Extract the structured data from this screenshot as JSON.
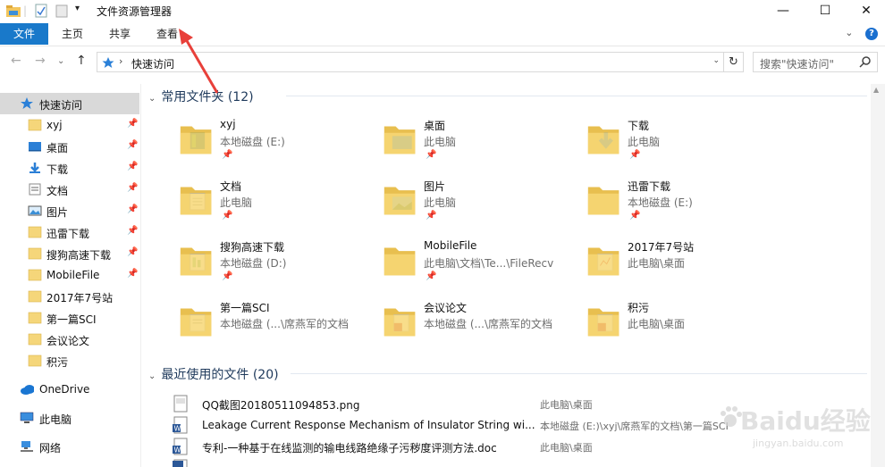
{
  "window": {
    "title": "文件资源管理器",
    "controls": {
      "minimize": "—",
      "maximize": "☐",
      "close": "✕"
    }
  },
  "ribbon": {
    "tabs": [
      {
        "label": "文件"
      },
      {
        "label": "主页"
      },
      {
        "label": "共享"
      },
      {
        "label": "查看"
      }
    ],
    "expand": "⌄"
  },
  "address": {
    "back": "←",
    "forward": "→",
    "recent": "⌄",
    "up": "↑",
    "separator": "›",
    "path": "快速访问",
    "dropdown": "⌄",
    "refresh": "↻",
    "search_placeholder": "搜索\"快速访问\""
  },
  "sidebar": {
    "quick_access": "快速访问",
    "items": [
      {
        "label": "xyj",
        "pinned": true,
        "icon": "folder-icon"
      },
      {
        "label": "桌面",
        "pinned": true,
        "icon": "desktop-icon"
      },
      {
        "label": "下载",
        "pinned": true,
        "icon": "download-icon"
      },
      {
        "label": "文档",
        "pinned": true,
        "icon": "document-icon"
      },
      {
        "label": "图片",
        "pinned": true,
        "icon": "picture-icon"
      },
      {
        "label": "迅雷下载",
        "pinned": true,
        "icon": "folder-icon"
      },
      {
        "label": "搜狗高速下载",
        "pinned": true,
        "icon": "folder-icon"
      },
      {
        "label": "MobileFile",
        "pinned": true,
        "icon": "folder-icon"
      },
      {
        "label": "2017年7号站",
        "pinned": false,
        "icon": "folder-icon"
      },
      {
        "label": "第一篇SCI",
        "pinned": false,
        "icon": "folder-icon"
      },
      {
        "label": "会议论文",
        "pinned": false,
        "icon": "folder-icon"
      },
      {
        "label": "积污",
        "pinned": false,
        "icon": "folder-icon"
      }
    ],
    "onedrive": "OneDrive",
    "this_pc": "此电脑",
    "network": "网络",
    "pin_glyph": "📌"
  },
  "frequent": {
    "header": "常用文件夹 (12)",
    "folders": [
      {
        "name": "xyj",
        "location": "本地磁盘 (E:)",
        "pinned": true
      },
      {
        "name": "桌面",
        "location": "此电脑",
        "pinned": true
      },
      {
        "name": "下载",
        "location": "此电脑",
        "pinned": true
      },
      {
        "name": "文档",
        "location": "此电脑",
        "pinned": true
      },
      {
        "name": "图片",
        "location": "此电脑",
        "pinned": true
      },
      {
        "name": "迅雷下载",
        "location": "本地磁盘 (E:)",
        "pinned": true
      },
      {
        "name": "搜狗高速下载",
        "location": "本地磁盘 (D:)",
        "pinned": true
      },
      {
        "name": "MobileFile",
        "location": "此电脑\\文档\\Te...\\FileRecv",
        "pinned": true
      },
      {
        "name": "2017年7号站",
        "location": "此电脑\\桌面",
        "pinned": false
      },
      {
        "name": "第一篇SCI",
        "location": "本地磁盘 (...\\席燕军的文档",
        "pinned": false
      },
      {
        "name": "会议论文",
        "location": "本地磁盘 (...\\席燕军的文档",
        "pinned": false
      },
      {
        "name": "积污",
        "location": "此电脑\\桌面",
        "pinned": false
      }
    ]
  },
  "recent": {
    "header": "最近使用的文件 (20)",
    "files": [
      {
        "name": "QQ截图20180511094853.png",
        "location": "此电脑\\桌面"
      },
      {
        "name": "Leakage Current Response Mechanism of Insulator String wi...",
        "location": "本地磁盘 (E:)\\xyj\\席燕军的文档\\第一篇SCI"
      },
      {
        "name": "专利-一种基于在线监测的输电线路绝缘子污秽度评测方法.doc",
        "location": "此电脑\\桌面"
      },
      {
        "name": "",
        "location": ""
      }
    ]
  },
  "watermark": {
    "brand": "Baidu经验",
    "url": "jingyan.baidu.com"
  },
  "colors": {
    "accent": "#1979ca",
    "selected": "#d9d9d9",
    "section_header": "#1e395b",
    "folder": "#f5d67a",
    "annotation_arrow": "#e8403a"
  }
}
